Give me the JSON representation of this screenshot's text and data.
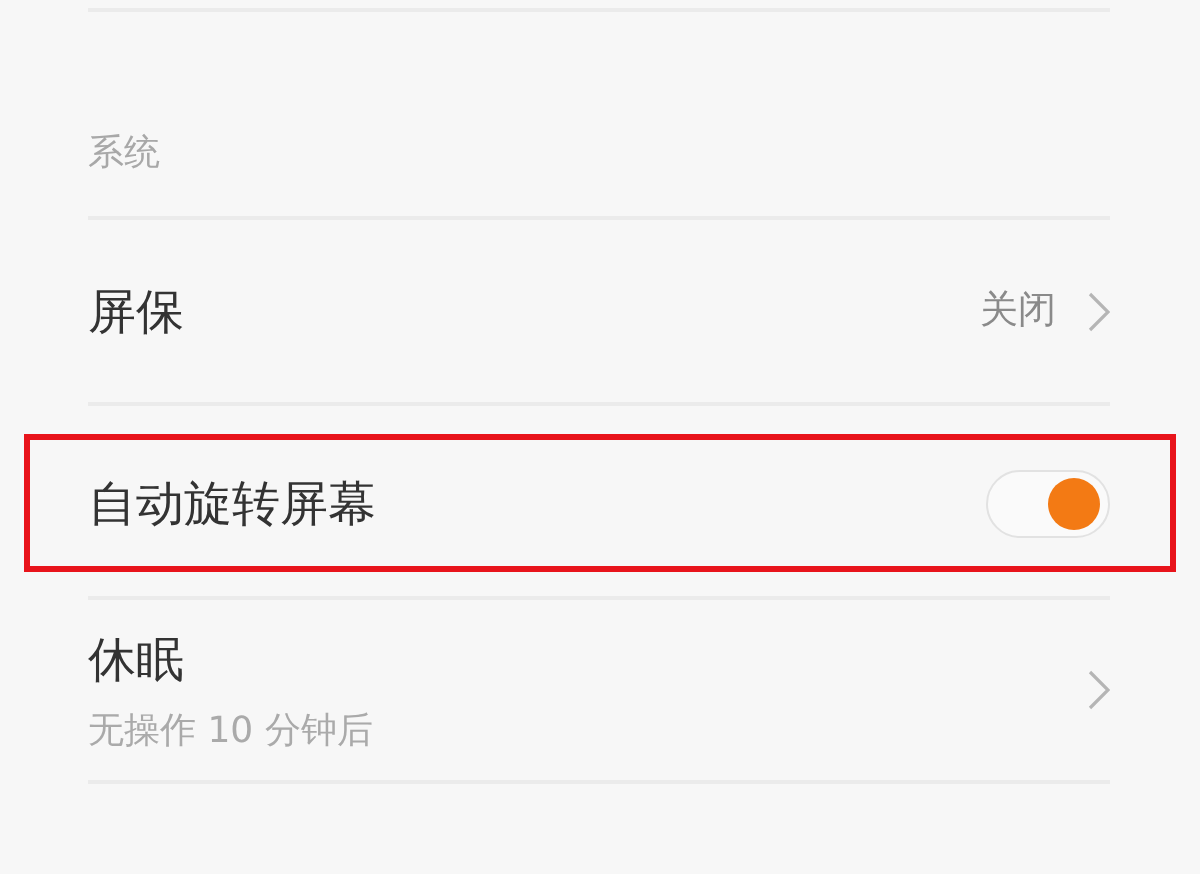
{
  "section": {
    "title": "系统"
  },
  "items": [
    {
      "kind": "link",
      "title": "屏保",
      "value": "关闭",
      "highlighted": false
    },
    {
      "kind": "switch",
      "title": "自动旋转屏幕",
      "on": true,
      "highlighted": true
    },
    {
      "kind": "link",
      "title": "休眠",
      "subtitle": "无操作 10 分钟后",
      "highlighted": false
    }
  ]
}
